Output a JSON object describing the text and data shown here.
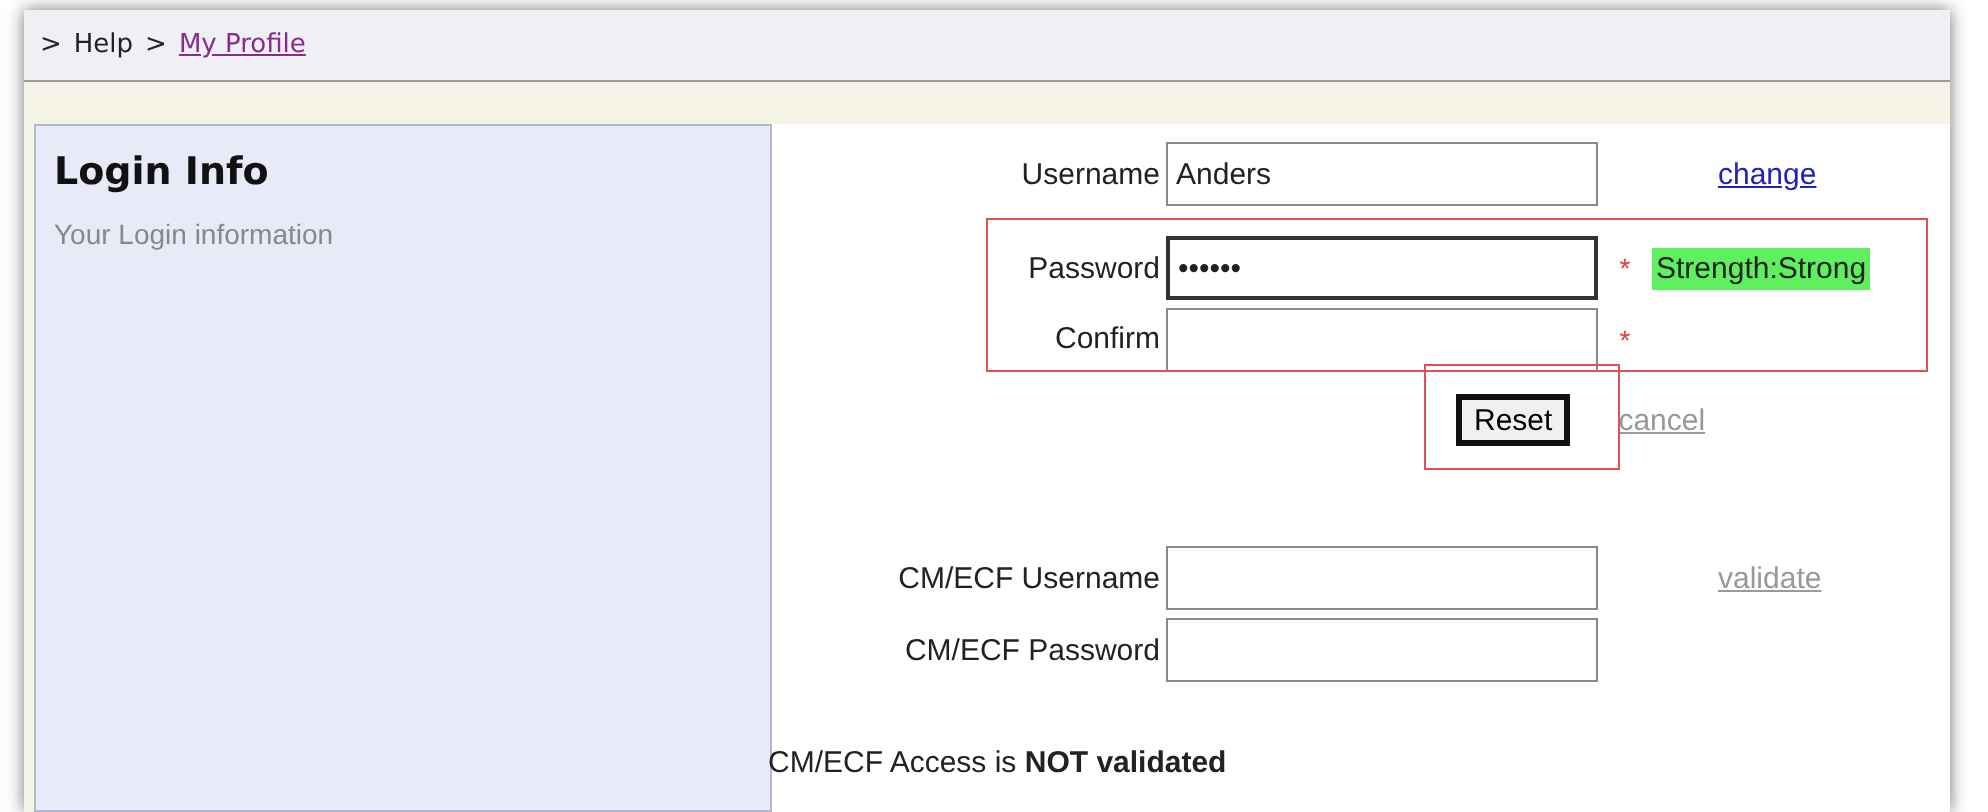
{
  "breadcrumb": {
    "separator": ">",
    "items": [
      {
        "text": "Help",
        "link": false
      },
      {
        "text": "My Profile",
        "link": true
      }
    ]
  },
  "panel": {
    "title": "Login Info",
    "subtitle": "Your Login information"
  },
  "login_fields": [
    {
      "label": "Username",
      "value": "Anders",
      "focused": false,
      "link": {
        "text": "change",
        "disabled": false
      }
    },
    {
      "label": "Password",
      "value": "••••••",
      "focused": true,
      "marker": "*",
      "strength": "Strength:Strong"
    },
    {
      "label": "Confirm",
      "focused": false,
      "marker": "*"
    }
  ],
  "reset": {
    "button": "Reset",
    "link": {
      "text": "cancel",
      "disabled": true
    }
  },
  "ecf_fields": [
    {
      "label": "CM/ECF Username",
      "focused": false,
      "link": {
        "text": "validate",
        "disabled": true
      }
    },
    {
      "label": "CM/ECF Password",
      "focused": false
    }
  ],
  "status": "CM/ECF Access is **NOT validated**"
}
